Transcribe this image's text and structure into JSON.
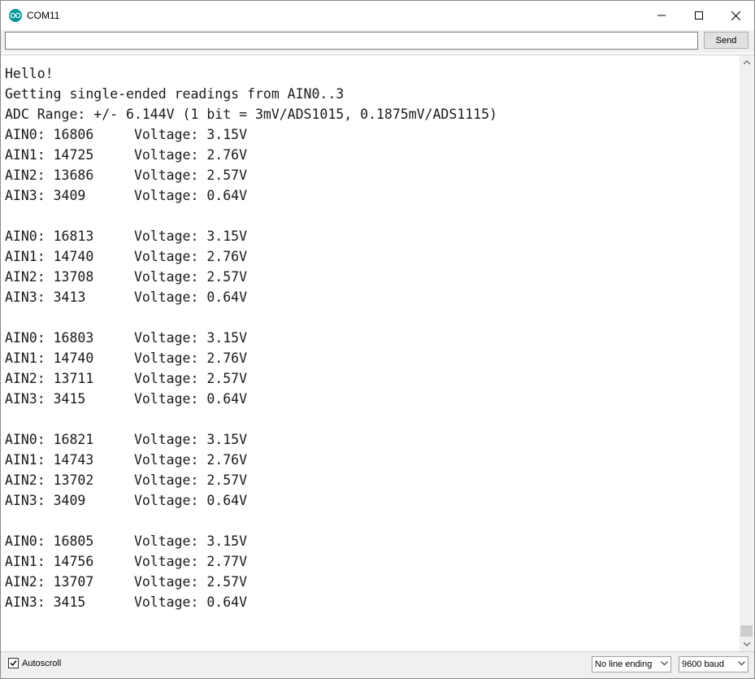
{
  "window": {
    "title": "COM11",
    "icon": "arduino-icon"
  },
  "input": {
    "value": "",
    "send_label": "Send"
  },
  "output": {
    "lines": [
      "Hello!",
      "Getting single-ended readings from AIN0..3",
      "ADC Range: +/- 6.144V (1 bit = 3mV/ADS1015, 0.1875mV/ADS1115)",
      "AIN0: 16806     Voltage: 3.15V",
      "AIN1: 14725     Voltage: 2.76V",
      "AIN2: 13686     Voltage: 2.57V",
      "AIN3: 3409      Voltage: 0.64V",
      "",
      "AIN0: 16813     Voltage: 3.15V",
      "AIN1: 14740     Voltage: 2.76V",
      "AIN2: 13708     Voltage: 2.57V",
      "AIN3: 3413      Voltage: 0.64V",
      "",
      "AIN0: 16803     Voltage: 3.15V",
      "AIN1: 14740     Voltage: 2.76V",
      "AIN2: 13711     Voltage: 2.57V",
      "AIN3: 3415      Voltage: 0.64V",
      "",
      "AIN0: 16821     Voltage: 3.15V",
      "AIN1: 14743     Voltage: 2.76V",
      "AIN2: 13702     Voltage: 2.57V",
      "AIN3: 3409      Voltage: 0.64V",
      "",
      "AIN0: 16805     Voltage: 3.15V",
      "AIN1: 14756     Voltage: 2.77V",
      "AIN2: 13707     Voltage: 2.57V",
      "AIN3: 3415      Voltage: 0.64V"
    ]
  },
  "status": {
    "autoscroll_label": "Autoscroll",
    "autoscroll_checked": true,
    "line_ending": "No line ending",
    "baud": "9600 baud"
  },
  "colors": {
    "app_icon": "#00979c",
    "background": "#f0f0f0"
  }
}
